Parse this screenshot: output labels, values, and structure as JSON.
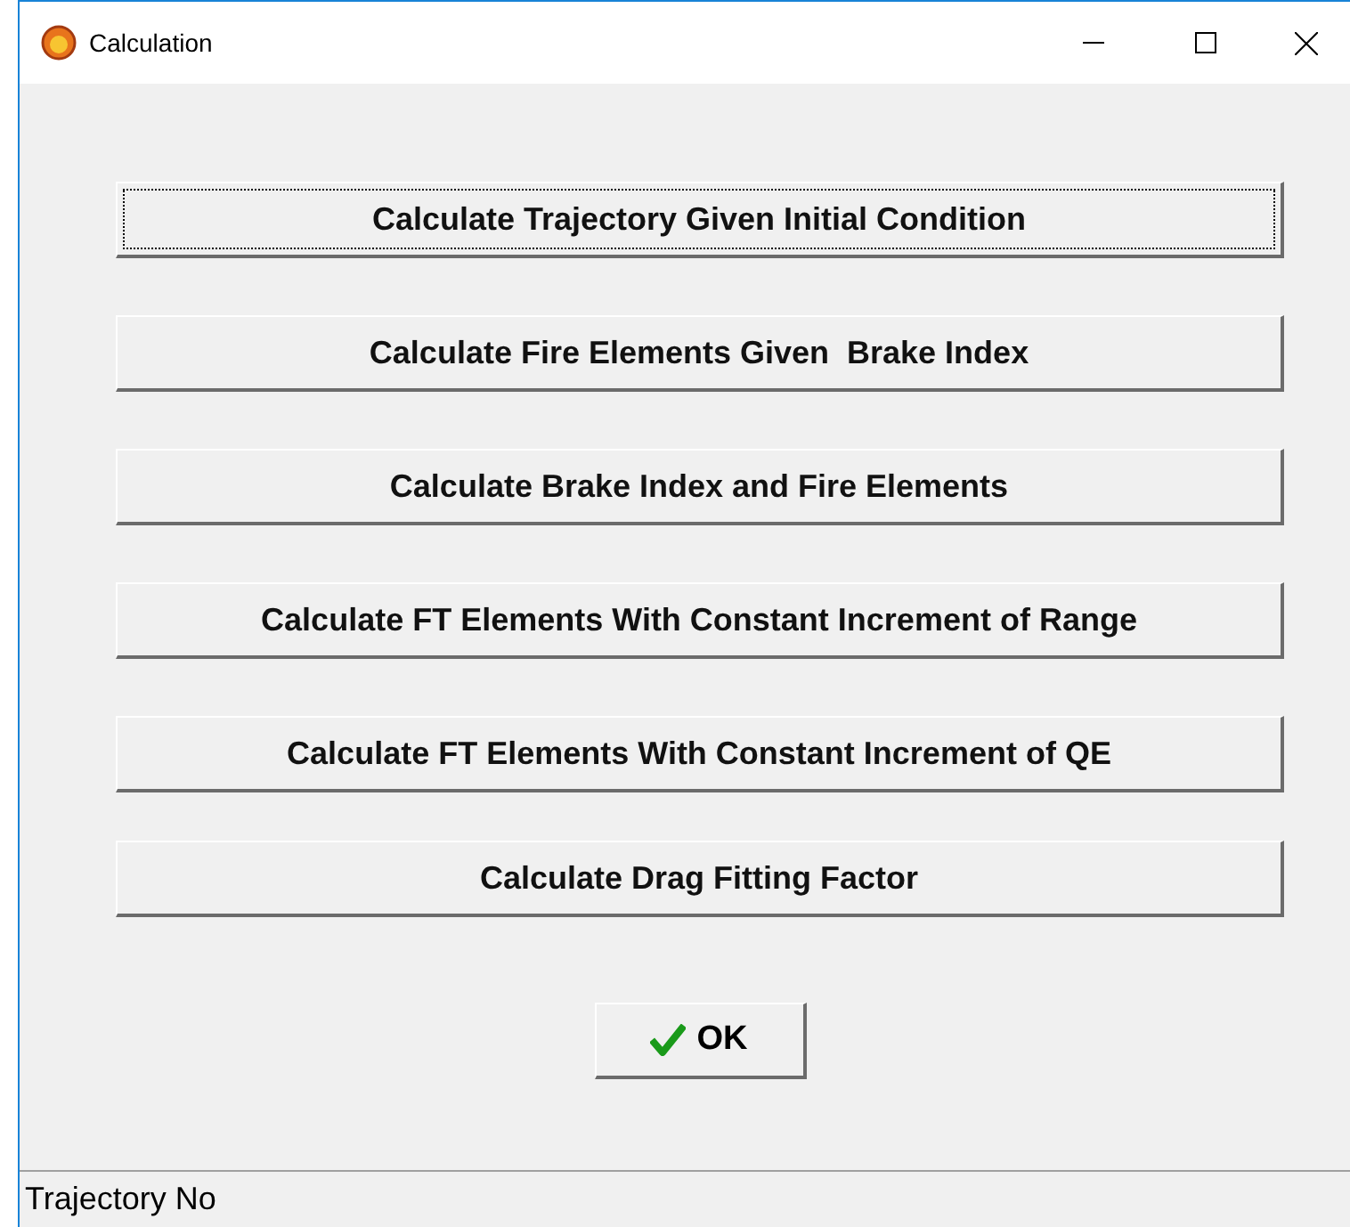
{
  "window": {
    "title": "Calculation"
  },
  "buttons": [
    {
      "label": "Calculate Trajectory Given Initial Condition",
      "focused": true
    },
    {
      "label": "Calculate Fire Elements Given  Brake Index",
      "focused": false
    },
    {
      "label": "Calculate Brake Index and Fire Elements",
      "focused": false
    },
    {
      "label": "Calculate FT Elements With Constant Increment of Range",
      "focused": false
    },
    {
      "label": "Calculate FT Elements With Constant Increment of QE",
      "focused": false
    },
    {
      "label": "Calculate Drag Fitting Factor",
      "focused": false
    }
  ],
  "ok_button": {
    "label": "OK"
  },
  "status_bar": {
    "text": "Trajectory No"
  }
}
